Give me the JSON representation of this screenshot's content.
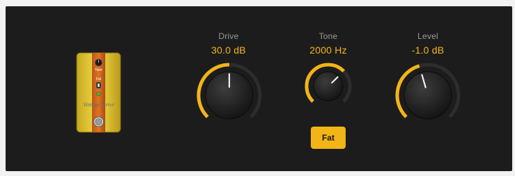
{
  "pedal": {
    "tone_label": "Tone",
    "fat_label": "Fat",
    "logo_text": "Vintage Drive"
  },
  "knobs": [
    {
      "id": "drive",
      "name": "Drive",
      "value": "30.0 dB",
      "level": 0.5
    },
    {
      "id": "tone",
      "name": "Tone",
      "value": "2000 Hz",
      "level": 0.67
    },
    {
      "id": "level",
      "name": "Level",
      "value": "-1.0 dB",
      "level": 0.44
    }
  ],
  "fat_button": {
    "label": "Fat",
    "active": true
  },
  "colors": {
    "accent": "#f2b417",
    "value_text": "#f4b71a",
    "panel": "#1c1c1c",
    "track": "#2d2d2d",
    "label_text": "#9a9a9a"
  }
}
